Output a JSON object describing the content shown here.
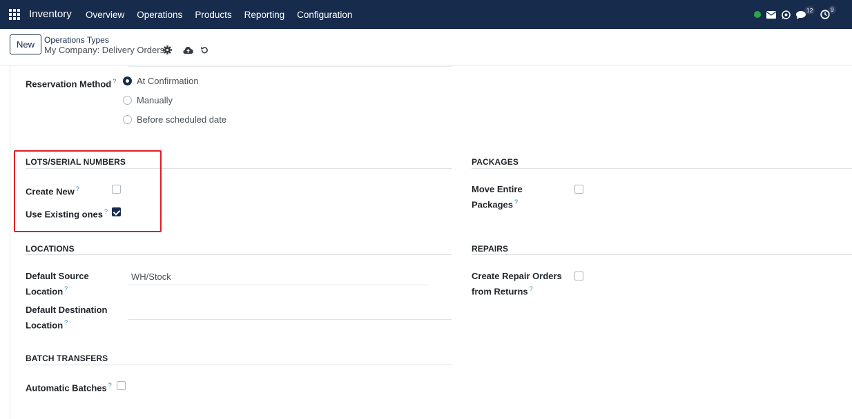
{
  "navbar": {
    "app_name": "Inventory",
    "menu": [
      "Overview",
      "Operations",
      "Products",
      "Reporting",
      "Configuration"
    ],
    "messages_count": "12",
    "activities_count": "9"
  },
  "control_panel": {
    "new_label": "New",
    "breadcrumb_parent": "Operations Types",
    "breadcrumb_current": "My Company: Delivery Orders"
  },
  "form": {
    "reservation": {
      "label": "Reservation Method",
      "options": [
        "At Confirmation",
        "Manually",
        "Before scheduled date"
      ],
      "selected_index": 0
    },
    "lots": {
      "title": "LOTS/SERIAL NUMBERS",
      "create_new": {
        "label": "Create New",
        "checked": false
      },
      "use_existing": {
        "label": "Use Existing ones",
        "checked": true
      }
    },
    "packages": {
      "title": "PACKAGES",
      "move_entire_line1": "Move Entire",
      "move_entire_line2": "Packages",
      "checked": false
    },
    "locations": {
      "title": "LOCATIONS",
      "source_line1": "Default Source",
      "source_line2": "Location",
      "source_value": "WH/Stock",
      "dest_line1": "Default Destination",
      "dest_line2": "Location",
      "dest_value": ""
    },
    "repairs": {
      "title": "REPAIRS",
      "line1": "Create Repair Orders",
      "line2": "from Returns",
      "checked": false
    },
    "batch": {
      "title": "BATCH TRANSFERS",
      "automatic_label": "Automatic Batches",
      "checked": false
    },
    "help_mark": "?"
  },
  "colors": {
    "navbar": "#172b4d",
    "highlight": "#e01b24",
    "status_online": "#28a745"
  }
}
